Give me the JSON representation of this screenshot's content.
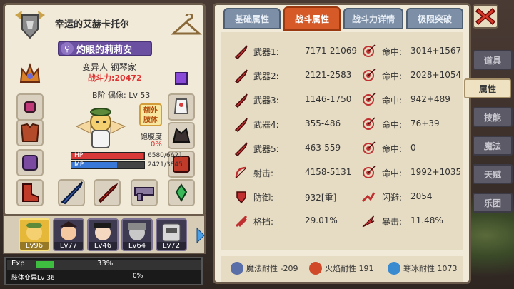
{
  "character": {
    "title": "幸运的艾赫卡托尔",
    "name_symbol": "♀",
    "name": "灼眼的莉莉安",
    "class_line": "变异人 钢琴家",
    "power": "战斗力:20472",
    "idol": "B阶 偶像: Lv 53",
    "extra_body_label": "额外\n肢体",
    "satiety_label": "饱腹度",
    "satiety_value": "0%",
    "hp_label": "HP",
    "hp_value": "6580/6621",
    "hp_fraction": 0.99,
    "mp_label": "MP",
    "mp_value": "2421/3845",
    "mp_fraction": 0.63
  },
  "team": [
    {
      "lv": "Lv96",
      "selected": true
    },
    {
      "lv": "Lv77",
      "selected": false
    },
    {
      "lv": "Lv46",
      "selected": false
    },
    {
      "lv": "Lv64",
      "selected": false
    },
    {
      "lv": "Lv72",
      "selected": false
    }
  ],
  "exp": {
    "label": "Exp",
    "percent": "33%",
    "fraction": 0.33,
    "body_label": "肢体变异Lv 36",
    "body_percent": "0%"
  },
  "tabs": [
    {
      "label": "基础属性",
      "active": false
    },
    {
      "label": "战斗属性",
      "active": true
    },
    {
      "label": "战斗力详情",
      "active": false
    },
    {
      "label": "极限突破",
      "active": false
    }
  ],
  "stats": [
    {
      "icon": "sword-icon",
      "name": "武器1:",
      "value": "7171-21069",
      "icon2": "target-icon",
      "name2": "命中:",
      "value2": "3014+1567"
    },
    {
      "icon": "sword-icon",
      "name": "武器2:",
      "value": "2121-2583",
      "icon2": "target-icon",
      "name2": "命中:",
      "value2": "2028+1054"
    },
    {
      "icon": "sword-icon",
      "name": "武器3:",
      "value": "1146-1750",
      "icon2": "target-icon",
      "name2": "命中:",
      "value2": "942+489"
    },
    {
      "icon": "sword-icon",
      "name": "武器4:",
      "value": "355-486",
      "icon2": "target-icon",
      "name2": "命中:",
      "value2": "76+39"
    },
    {
      "icon": "sword-icon",
      "name": "武器5:",
      "value": "463-559",
      "icon2": "target-icon",
      "name2": "命中:",
      "value2": "0"
    },
    {
      "icon": "bow-icon",
      "name": "射击:",
      "value": "4158-5131",
      "icon2": "target-icon",
      "name2": "命中:",
      "value2": "1992+1035"
    },
    {
      "icon": "shield-icon",
      "name": "防御:",
      "value": "932[重]",
      "icon2": "dodge-icon",
      "name2": "闪避:",
      "value2": "2054"
    },
    {
      "icon": "block-icon",
      "name": "格挡:",
      "value": "29.01%",
      "icon2": "crit-icon",
      "name2": "暴击:",
      "value2": "11.48%"
    }
  ],
  "resists": [
    {
      "icon": "magic-icon",
      "text": "魔法耐性 -209",
      "color": "#5a6ea8"
    },
    {
      "icon": "fire-icon",
      "text": "火焰耐性 191",
      "color": "#d04a2a"
    },
    {
      "icon": "ice-icon",
      "text": "寒冰耐性 1073",
      "color": "#3a8ad0"
    }
  ],
  "side_menu": [
    {
      "label": "道具",
      "active": false
    },
    {
      "label": "属性",
      "active": true
    },
    {
      "label": "技能",
      "active": false
    },
    {
      "label": "魔法",
      "active": false
    },
    {
      "label": "天赋",
      "active": false
    },
    {
      "label": "乐团",
      "active": false
    }
  ],
  "colors": {
    "accent": "#d55a28",
    "hp": "#d83a3a",
    "mp": "#3a78d8",
    "exp": "#3fbf3f"
  }
}
